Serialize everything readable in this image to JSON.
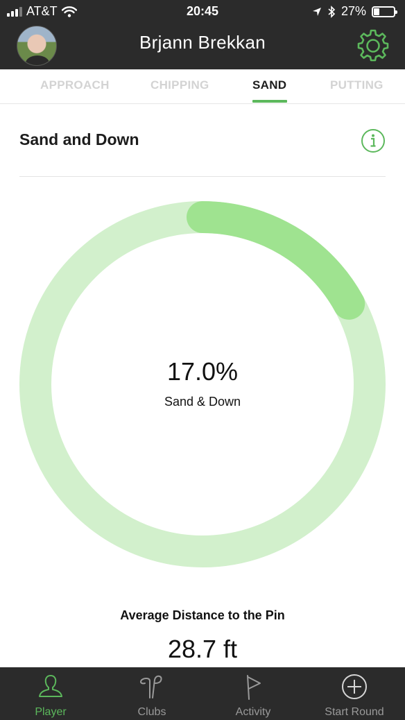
{
  "status_bar": {
    "carrier": "AT&T",
    "time": "20:45",
    "battery_percent": "27%",
    "battery_level": 0.27,
    "icons": [
      "signal-icon",
      "wifi-icon",
      "location-icon",
      "bluetooth-icon",
      "battery-icon"
    ]
  },
  "header": {
    "player_name": "Brjann Brekkan",
    "settings_icon": "gear-icon"
  },
  "tabs": [
    {
      "label": "APPROACH",
      "active": false
    },
    {
      "label": "CHIPPING",
      "active": false
    },
    {
      "label": "SAND",
      "active": true
    },
    {
      "label": "PUTTING",
      "active": false
    }
  ],
  "section": {
    "title": "Sand and Down",
    "info_icon": "info-icon"
  },
  "ring": {
    "value_text": "17.0%",
    "label": "Sand & Down",
    "fraction": 0.17
  },
  "average": {
    "label": "Average Distance to the Pin",
    "value": "28.7 ft"
  },
  "bottom_nav": [
    {
      "label": "Player",
      "icon": "player-icon",
      "active": true
    },
    {
      "label": "Clubs",
      "icon": "clubs-icon",
      "active": false
    },
    {
      "label": "Activity",
      "icon": "flag-icon",
      "active": false
    },
    {
      "label": "Start Round",
      "icon": "plus-circle-icon",
      "active": false
    }
  ],
  "colors": {
    "accent": "#5cb85c",
    "ring_track": "#d2f0cc",
    "ring_fill": "#9fe390",
    "bar_background": "#2b2b2b"
  }
}
